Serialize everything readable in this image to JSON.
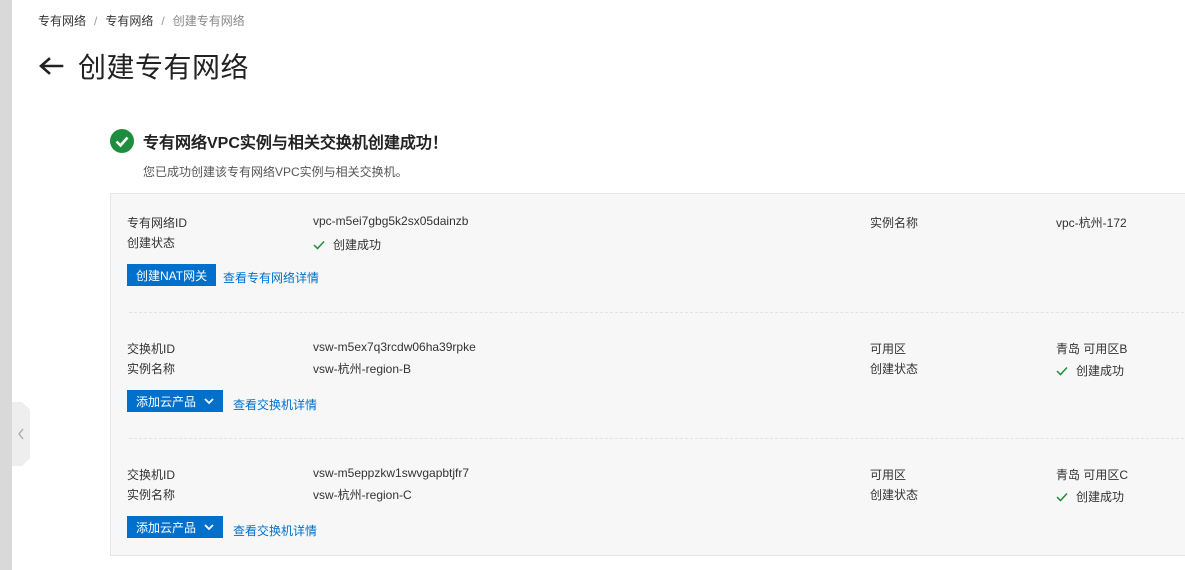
{
  "breadcrumb": {
    "items": [
      "专有网络",
      "专有网络",
      "创建专有网络"
    ],
    "separator": "/"
  },
  "page": {
    "title": "创建专有网络"
  },
  "result": {
    "title": "专有网络VPC实例与相关交换机创建成功！",
    "subtitle": "您已成功创建该专有网络VPC实例与相关交换机。"
  },
  "vpc": {
    "id_label": "专有网络ID",
    "id_value": "vpc-m5ei7gbg5k2sx05dainzb",
    "status_label": "创建状态",
    "status_value": "创建成功",
    "name_label": "实例名称",
    "name_value": "vpc-杭州-172",
    "create_nat_label": "创建NAT网关",
    "detail_link": "查看专有网络详情"
  },
  "vswitches": [
    {
      "id_label": "交换机ID",
      "id_value": "vsw-m5ex7q3rcdw06ha39rpke",
      "name_label": "实例名称",
      "name_value": "vsw-杭州-region-B",
      "zone_label": "可用区",
      "zone_value": "青岛 可用区B",
      "status_label": "创建状态",
      "status_value": "创建成功",
      "add_product_label": "添加云产品",
      "detail_link": "查看交换机详情"
    },
    {
      "id_label": "交换机ID",
      "id_value": "vsw-m5eppzkw1swvgapbtjfr7",
      "name_label": "实例名称",
      "name_value": "vsw-杭州-region-C",
      "zone_label": "可用区",
      "zone_value": "青岛 可用区C",
      "status_label": "创建状态",
      "status_value": "创建成功",
      "add_product_label": "添加云产品",
      "detail_link": "查看交换机详情"
    }
  ],
  "colors": {
    "primary": "#0070cc",
    "success": "#1e8e3e",
    "panel_bg": "#f7f7f7"
  },
  "icons": [
    "chevron-left-icon",
    "back-arrow-icon",
    "success-check-icon",
    "check-icon",
    "caret-down-icon"
  ]
}
